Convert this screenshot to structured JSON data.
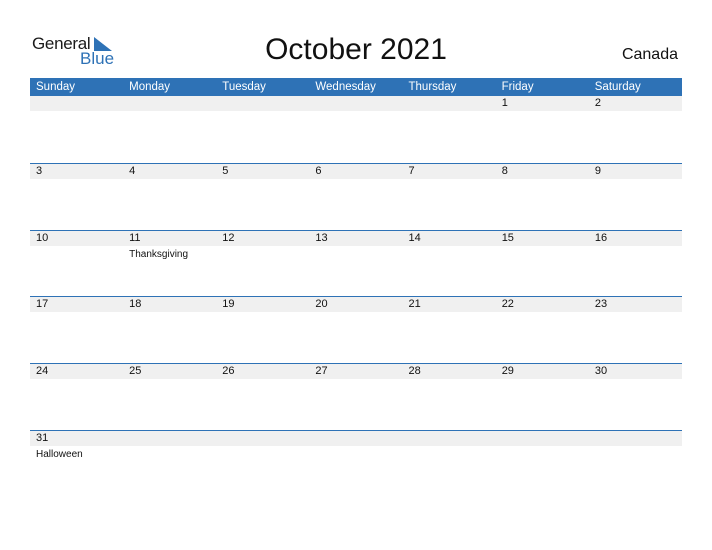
{
  "logo": {
    "general": "General",
    "blue": "Blue"
  },
  "title": "October 2021",
  "country": "Canada",
  "days": [
    "Sunday",
    "Monday",
    "Tuesday",
    "Wednesday",
    "Thursday",
    "Friday",
    "Saturday"
  ],
  "weeks": [
    [
      {
        "d": "",
        "e": ""
      },
      {
        "d": "",
        "e": ""
      },
      {
        "d": "",
        "e": ""
      },
      {
        "d": "",
        "e": ""
      },
      {
        "d": "",
        "e": ""
      },
      {
        "d": "1",
        "e": ""
      },
      {
        "d": "2",
        "e": ""
      }
    ],
    [
      {
        "d": "3",
        "e": ""
      },
      {
        "d": "4",
        "e": ""
      },
      {
        "d": "5",
        "e": ""
      },
      {
        "d": "6",
        "e": ""
      },
      {
        "d": "7",
        "e": ""
      },
      {
        "d": "8",
        "e": ""
      },
      {
        "d": "9",
        "e": ""
      }
    ],
    [
      {
        "d": "10",
        "e": ""
      },
      {
        "d": "11",
        "e": "Thanksgiving"
      },
      {
        "d": "12",
        "e": ""
      },
      {
        "d": "13",
        "e": ""
      },
      {
        "d": "14",
        "e": ""
      },
      {
        "d": "15",
        "e": ""
      },
      {
        "d": "16",
        "e": ""
      }
    ],
    [
      {
        "d": "17",
        "e": ""
      },
      {
        "d": "18",
        "e": ""
      },
      {
        "d": "19",
        "e": ""
      },
      {
        "d": "20",
        "e": ""
      },
      {
        "d": "21",
        "e": ""
      },
      {
        "d": "22",
        "e": ""
      },
      {
        "d": "23",
        "e": ""
      }
    ],
    [
      {
        "d": "24",
        "e": ""
      },
      {
        "d": "25",
        "e": ""
      },
      {
        "d": "26",
        "e": ""
      },
      {
        "d": "27",
        "e": ""
      },
      {
        "d": "28",
        "e": ""
      },
      {
        "d": "29",
        "e": ""
      },
      {
        "d": "30",
        "e": ""
      }
    ],
    [
      {
        "d": "31",
        "e": "Halloween"
      },
      {
        "d": "",
        "e": ""
      },
      {
        "d": "",
        "e": ""
      },
      {
        "d": "",
        "e": ""
      },
      {
        "d": "",
        "e": ""
      },
      {
        "d": "",
        "e": ""
      },
      {
        "d": "",
        "e": ""
      }
    ]
  ]
}
